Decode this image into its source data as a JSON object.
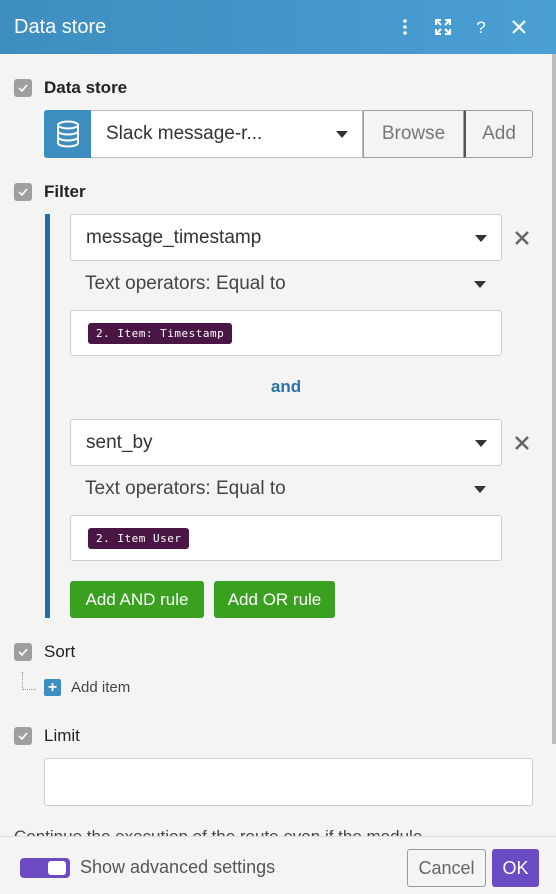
{
  "header": {
    "title": "Data store"
  },
  "data_store": {
    "section_label": "Data store",
    "selected": "Slack message-r...",
    "browse_label": "Browse",
    "add_label": "Add"
  },
  "filter": {
    "section_label": "Filter",
    "rules": [
      {
        "field": "message_timestamp",
        "operator": "Text operators: Equal to",
        "value": "2. Item: Timestamp"
      },
      {
        "field": "sent_by",
        "operator": "Text operators: Equal to",
        "value": "2. Item User"
      }
    ],
    "conjunction": "and",
    "add_and_label": "Add AND rule",
    "add_or_label": "Add OR rule"
  },
  "sort": {
    "section_label": "Sort",
    "add_item_label": "Add item"
  },
  "limit": {
    "section_label": "Limit",
    "value": ""
  },
  "cutoff": {
    "text": "Continue the execution of the route even if the module"
  },
  "footer": {
    "advanced_label": "Show advanced settings",
    "advanced_on": true,
    "cancel_label": "Cancel",
    "ok_label": "OK"
  },
  "colors": {
    "header_blue": "#3d8dc0",
    "filter_bar": "#1f6fa5",
    "green_button": "#3aa020",
    "purple_accent": "#6b4bc4",
    "pill_bg": "#4a1744"
  },
  "icons": [
    "dots-vertical-icon",
    "expand-icon",
    "help-icon",
    "close-icon",
    "database-icon",
    "checkbox-icon",
    "remove-icon",
    "plus-icon"
  ]
}
